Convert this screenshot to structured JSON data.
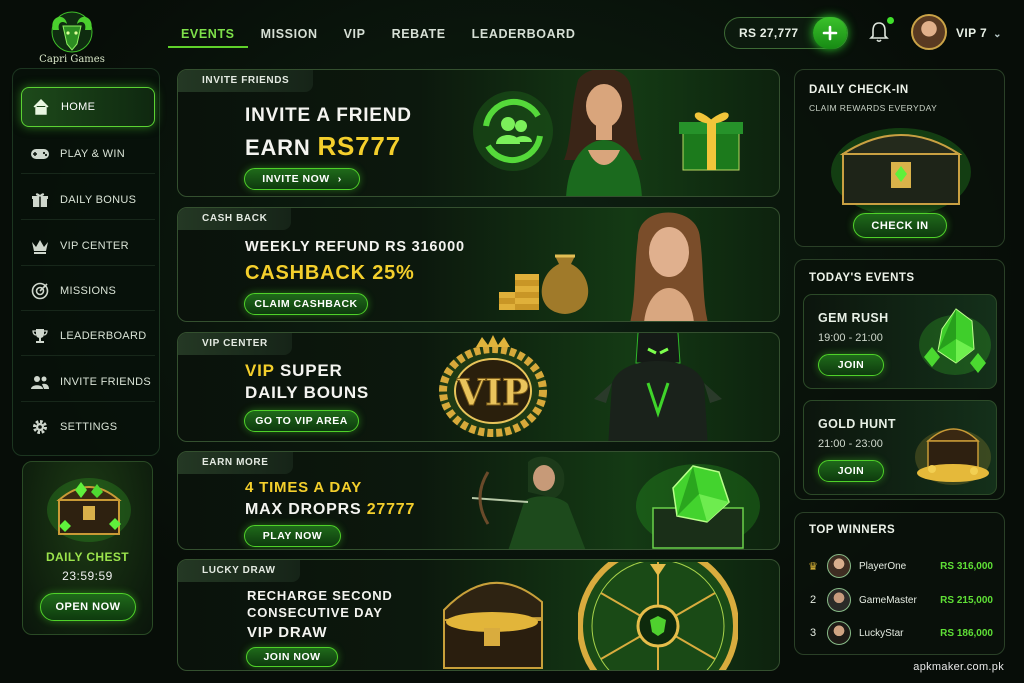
{
  "brand": {
    "name": "Capri Games"
  },
  "nav": {
    "tabs": [
      {
        "label": "EVENTS",
        "active": true
      },
      {
        "label": "MISSION"
      },
      {
        "label": "VIP"
      },
      {
        "label": "REBATE"
      },
      {
        "label": "LEADERBOARD"
      }
    ]
  },
  "account": {
    "balance": "RS 27,777",
    "vip_level": "VIP 7"
  },
  "sidebar": {
    "items": [
      {
        "label": "HOME",
        "icon": "home-icon",
        "active": true
      },
      {
        "label": "PLAY & WIN",
        "icon": "gamepad-icon"
      },
      {
        "label": "DAILY BONUS",
        "icon": "gift-icon"
      },
      {
        "label": "VIP CENTER",
        "icon": "crown-icon"
      },
      {
        "label": "MISSIONS",
        "icon": "target-icon"
      },
      {
        "label": "LEADERBOARD",
        "icon": "trophy-icon"
      },
      {
        "label": "INVITE FRIENDS",
        "icon": "users-icon"
      },
      {
        "label": "SETTINGS",
        "icon": "gear-icon"
      }
    ]
  },
  "daily_chest": {
    "title": "DAILY CHEST",
    "timer": "23:59:59",
    "button": "OPEN NOW"
  },
  "banners": {
    "invite": {
      "tag": "INVITE FRIENDS",
      "line1": "INVITE A FRIEND",
      "line2a": "EARN ",
      "line2b": "RS777",
      "button": "INVITE NOW"
    },
    "cashback": {
      "tag": "CASH BACK",
      "line1": "WEEKLY REFUND RS 316000",
      "line2": "CASHBACK 25%",
      "button": "CLAIM CASHBACK"
    },
    "vip": {
      "tag": "VIP CENTER",
      "line1a": "VIP",
      "line1b": " SUPER",
      "line2": "DAILY BOUNS",
      "button": "GO TO VIP AREA",
      "emblem": "VIP"
    },
    "earn": {
      "tag": "EARN MORE",
      "line1": "4 TIMES A DAY",
      "line2a": "MAX DROPRS ",
      "line2b": "27777",
      "button": "PLAY NOW"
    },
    "lucky": {
      "tag": "LUCKY DRAW",
      "line1": "RECHARGE SECOND",
      "line2": "CONSECUTIVE DAY",
      "line3": "VIP DRAW",
      "button": "JOIN NOW"
    }
  },
  "checkin": {
    "title": "DAILY CHECK-IN",
    "subtitle": "CLAIM REWARDS EVERYDAY",
    "button": "CHECK IN"
  },
  "events": {
    "title": "TODAY'S EVENTS",
    "items": [
      {
        "name": "GEM RUSH",
        "time": "19:00 - 21:00",
        "button": "JOIN"
      },
      {
        "name": "GOLD HUNT",
        "time": "21:00 - 23:00",
        "button": "JOIN"
      }
    ]
  },
  "winners": {
    "title": "TOP WINNERS",
    "rows": [
      {
        "rank": "♛",
        "name": "PlayerOne",
        "amount": "RS 316,000"
      },
      {
        "rank": "2",
        "name": "GameMaster",
        "amount": "RS 215,000"
      },
      {
        "rank": "3",
        "name": "LuckyStar",
        "amount": "RS 186,000"
      }
    ]
  },
  "footer": {
    "watermark": "apkmaker.com.pk"
  },
  "colors": {
    "accent": "#5fd12a",
    "gold": "#f4cf2c",
    "bg": "#07100a"
  }
}
